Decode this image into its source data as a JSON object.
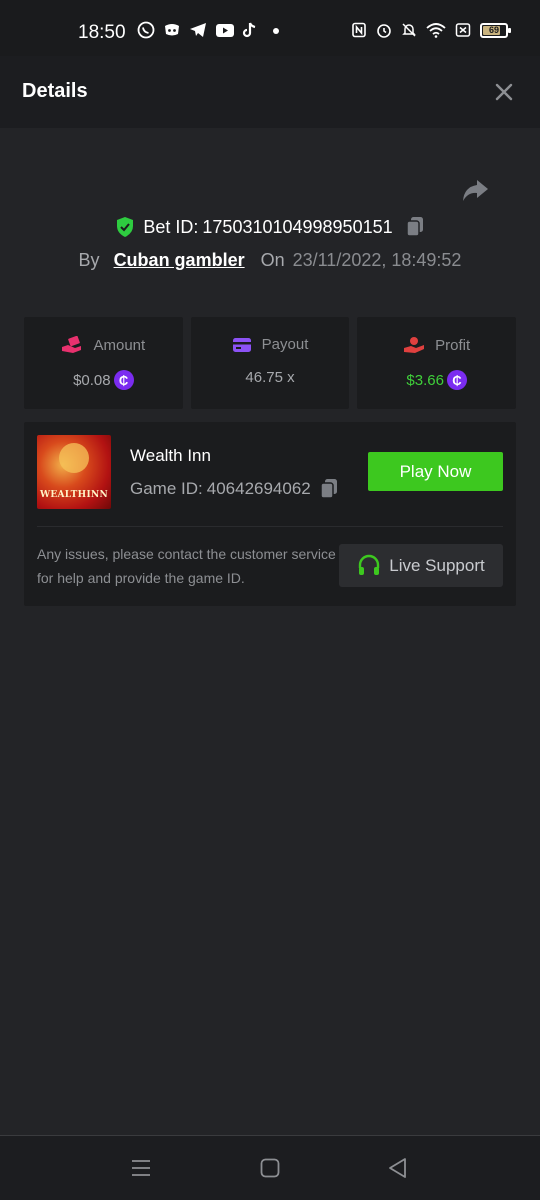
{
  "status_bar": {
    "time": "18:50",
    "battery": "69",
    "app_icons": [
      "whatsapp-icon",
      "discord-icon",
      "telegram-icon",
      "youtube-icon",
      "tiktok-icon",
      "dot-icon"
    ],
    "system_icons": [
      "nfc-icon",
      "alarm-icon",
      "mute-icon",
      "wifi-icon",
      "x-box-icon"
    ]
  },
  "header": {
    "title": "Details"
  },
  "bet": {
    "id_label": "Bet ID:",
    "id_value": "1750310104998950151",
    "by_label": "By",
    "user": "Cuban gambler",
    "on_label": "On",
    "date": "23/11/2022, 18:49:52"
  },
  "stats": [
    {
      "label": "Amount",
      "value": "$0.08",
      "icon": "hand-coins-icon",
      "icon_color": "#e8316e",
      "coin": true
    },
    {
      "label": "Payout",
      "value": "46.75 x",
      "icon": "card-icon",
      "icon_color": "#8c52f5",
      "coin": false
    },
    {
      "label": "Profit",
      "value": "$3.66",
      "icon": "profit-hand-icon",
      "icon_color": "#e0403f",
      "coin": true
    }
  ],
  "game": {
    "name": "Wealth Inn",
    "id_label": "Game ID:",
    "id_value": "40642694062",
    "thumb_text": "WEALTHINN",
    "play_label": "Play Now",
    "help_text": "Any issues, please contact the customer service for help and provide the game ID.",
    "support_label": "Live Support"
  },
  "colors": {
    "accent_green": "#3dc81f",
    "coin_purple": "#7b2cf0",
    "profit_green": "#3fcf3a",
    "shield_green": "#2ecc40"
  }
}
